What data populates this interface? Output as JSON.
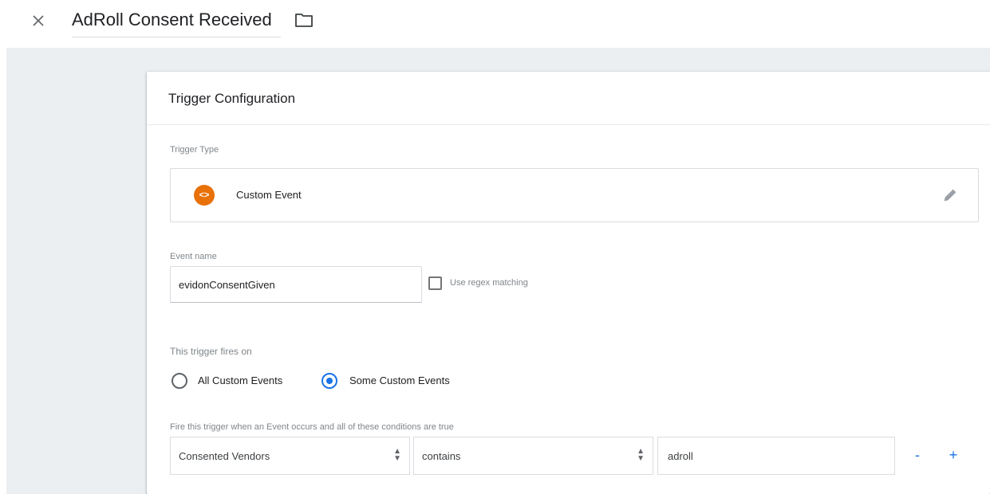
{
  "header": {
    "title": "AdRoll Consent Received",
    "close_icon": "close-icon",
    "folder_icon": "folder-icon"
  },
  "card": {
    "title": "Trigger Configuration",
    "trigger_type_label": "Trigger Type",
    "trigger_type": {
      "name": "Custom Event",
      "icon": "custom-event-icon",
      "icon_glyph": "<>",
      "icon_color": "#e8710a",
      "edit_icon": "pencil-icon"
    },
    "event_name_label": "Event name",
    "event_name_value": "evidonConsentGiven",
    "regex_checkbox": {
      "label": "Use regex matching",
      "checked": false
    },
    "fires_on_label": "This trigger fires on",
    "fires_on_options": [
      {
        "label": "All Custom Events",
        "selected": false
      },
      {
        "label": "Some Custom Events",
        "selected": true
      }
    ],
    "conditions_label": "Fire this trigger when an Event occurs and all of these conditions are true",
    "condition": {
      "variable": "Consented Vendors",
      "operator": "contains",
      "value": "adroll"
    },
    "remove_label": "-",
    "add_label": "+"
  },
  "colors": {
    "accent": "#1a73e8",
    "canvas_bg": "#eceff1"
  }
}
